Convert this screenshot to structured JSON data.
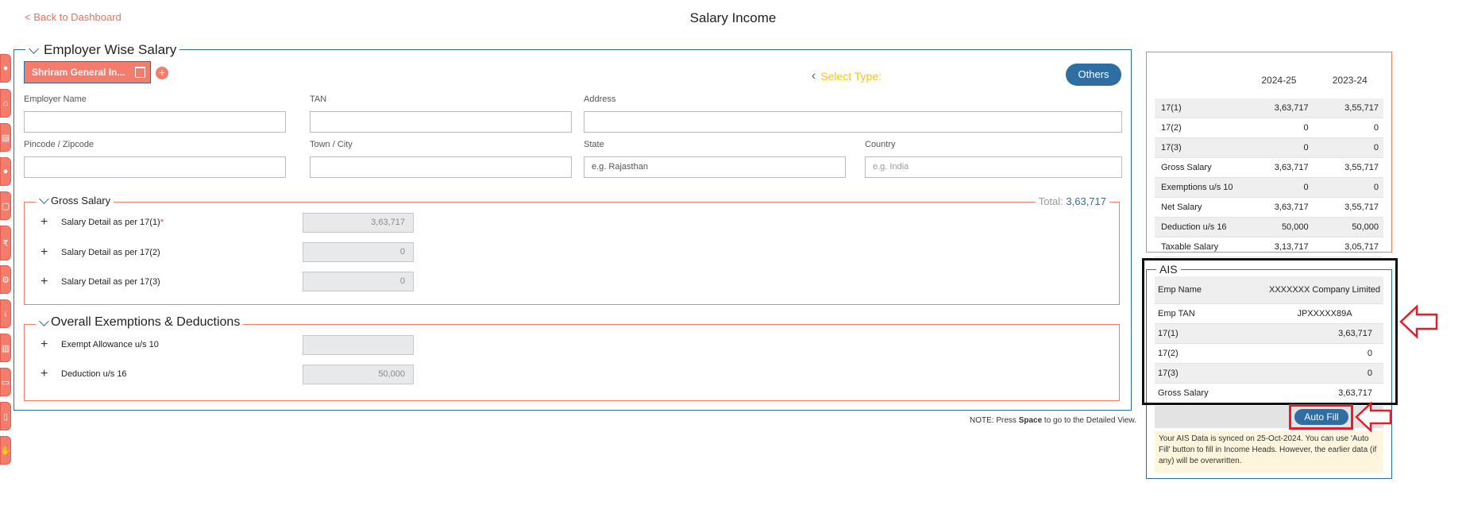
{
  "header": {
    "back_label": "< Back to Dashboard",
    "title": "Salary Income"
  },
  "employer": {
    "section_title": "Employer Wise Salary",
    "tab_label": "Shriram General In...",
    "select_type_label": "Select Type:",
    "type_button": "Others",
    "fields": {
      "employer_name": {
        "label": "Employer Name",
        "value": ""
      },
      "tan": {
        "label": "TAN",
        "value": ""
      },
      "address": {
        "label": "Address",
        "value": ""
      },
      "pincode": {
        "label": "Pincode / Zipcode",
        "value": ""
      },
      "town": {
        "label": "Town / City",
        "value": ""
      },
      "state": {
        "label": "State",
        "placeholder": "e.g. Rajasthan"
      },
      "country": {
        "label": "Country",
        "placeholder": "e.g. India"
      }
    }
  },
  "gross_salary": {
    "title": "Gross Salary",
    "total_label": "Total:",
    "total_value": "3,63,717",
    "rows": [
      {
        "label": "Salary Detail as per 17(1)",
        "required": "*",
        "value": "3,63,717"
      },
      {
        "label": "Salary Detail as per 17(2)",
        "value": "0"
      },
      {
        "label": "Salary Detail as per 17(3)",
        "value": "0"
      }
    ]
  },
  "exemptions": {
    "title": "Overall Exemptions & Deductions",
    "rows": [
      {
        "label": "Exempt Allowance u/s 10",
        "value": ""
      },
      {
        "label": "Deduction u/s 16",
        "value": "50,000"
      }
    ]
  },
  "note": {
    "prefix": "NOTE: Press ",
    "key": "Space",
    "suffix": " to go to the Detailed View."
  },
  "summary": {
    "columns": [
      "",
      "2024-25",
      "2023-24"
    ],
    "rows": [
      {
        "label": "17(1)",
        "y1": "3,63,717",
        "y2": "3,55,717"
      },
      {
        "label": "17(2)",
        "y1": "0",
        "y2": "0"
      },
      {
        "label": "17(3)",
        "y1": "0",
        "y2": "0"
      },
      {
        "label": "Gross Salary",
        "y1": "3,63,717",
        "y2": "3,55,717"
      },
      {
        "label": "Exemptions u/s 10",
        "y1": "0",
        "y2": "0"
      },
      {
        "label": "Net Salary",
        "y1": "3,63,717",
        "y2": "3,55,717"
      },
      {
        "label": "Deduction u/s 16",
        "y1": "50,000",
        "y2": "50,000"
      },
      {
        "label": "Taxable Salary",
        "y1": "3,13,717",
        "y2": "3,05,717"
      }
    ]
  },
  "ais": {
    "title": "AIS",
    "rows": [
      {
        "label": "Emp Name",
        "value": "XXXXXXX Company Limited"
      },
      {
        "label": "Emp TAN",
        "value": "JPXXXXX89A"
      },
      {
        "label": "17(1)",
        "value": "3,63,717"
      },
      {
        "label": "17(2)",
        "value": "0"
      },
      {
        "label": "17(3)",
        "value": "0"
      },
      {
        "label": "Gross Salary",
        "value": "3,63,717"
      }
    ],
    "autofill_label": "Auto Fill",
    "info": "Your AIS Data is synced on 25-Oct-2024. You can use 'Auto Fill' button to fill in Income Heads. However, the earlier data (if any) will be overwritten."
  },
  "colors": {
    "accent": "#f47c6c",
    "primary": "#2e6ea3",
    "highlight": "#e31e2b"
  }
}
